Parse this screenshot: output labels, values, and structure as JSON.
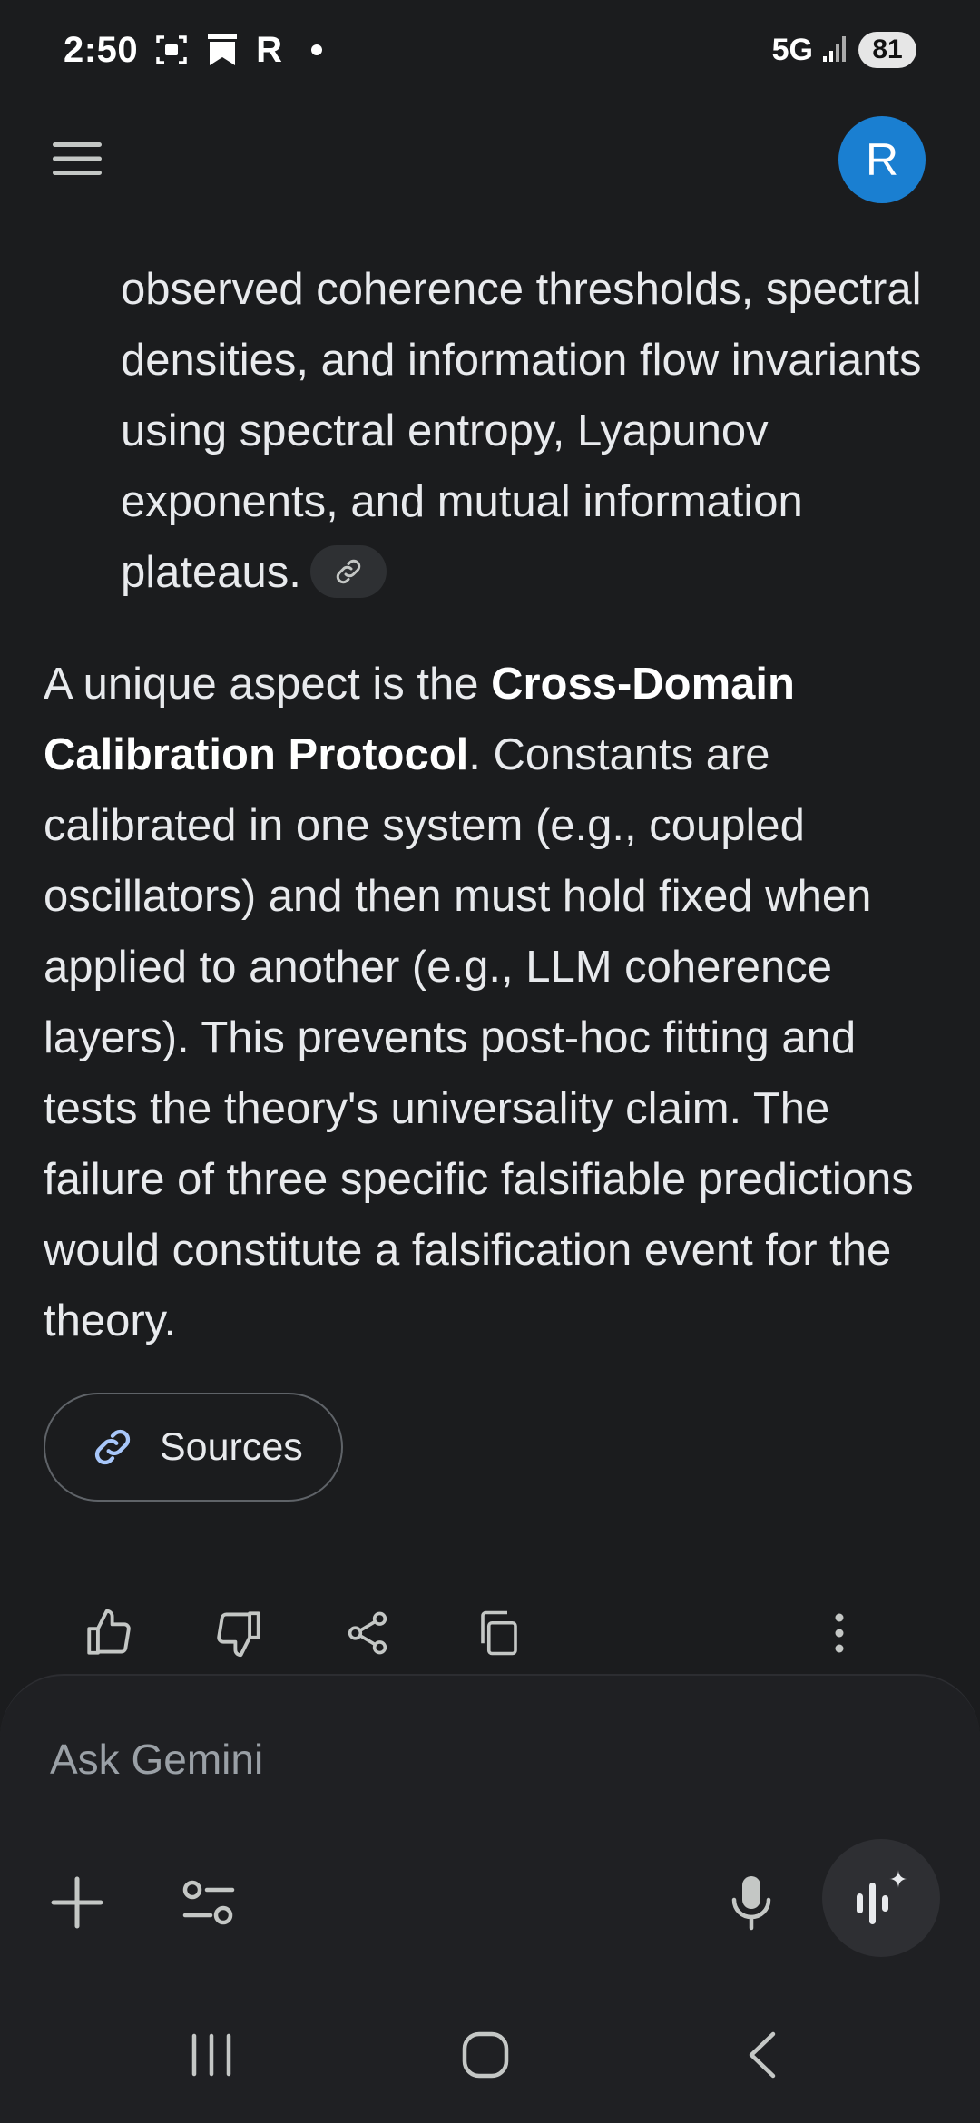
{
  "status_bar": {
    "time": "2:50",
    "r_label": "R",
    "network": "5G",
    "battery": "81"
  },
  "header": {
    "avatar_initial": "R"
  },
  "response": {
    "para1": "observed coherence thresholds, spectral densities, and information flow invariants using spectral entropy, Lyapunov exponents, and mutual information plateaus.",
    "para2_prefix": "A unique aspect is the ",
    "para2_bold": "Cross-Domain Calibration Protocol",
    "para2_suffix": ". Constants are calibrated in one system (e.g., coupled oscillators) and then must hold fixed when applied to another (e.g., LLM coherence layers). This prevents post-hoc fitting and tests the theory's universality claim. The failure of three specific falsifiable predictions would constitute a falsification event for the theory."
  },
  "sources": {
    "label": "Sources"
  },
  "composer": {
    "placeholder": "Ask Gemini"
  },
  "colors": {
    "background": "#1b1c1e",
    "composer_bg": "#1f2023",
    "avatar": "#1a7fd1",
    "sources_link_icon": "#a8c7fa"
  },
  "icons": {
    "menu": "hamburger-icon",
    "link": "link-icon",
    "thumbs_up": "thumbs-up-icon",
    "thumbs_down": "thumbs-down-icon",
    "share": "share-icon",
    "copy": "copy-icon",
    "more": "more-vert-icon",
    "plus": "plus-icon",
    "tools": "tune-icon",
    "mic": "mic-icon",
    "live": "gemini-live-icon"
  }
}
